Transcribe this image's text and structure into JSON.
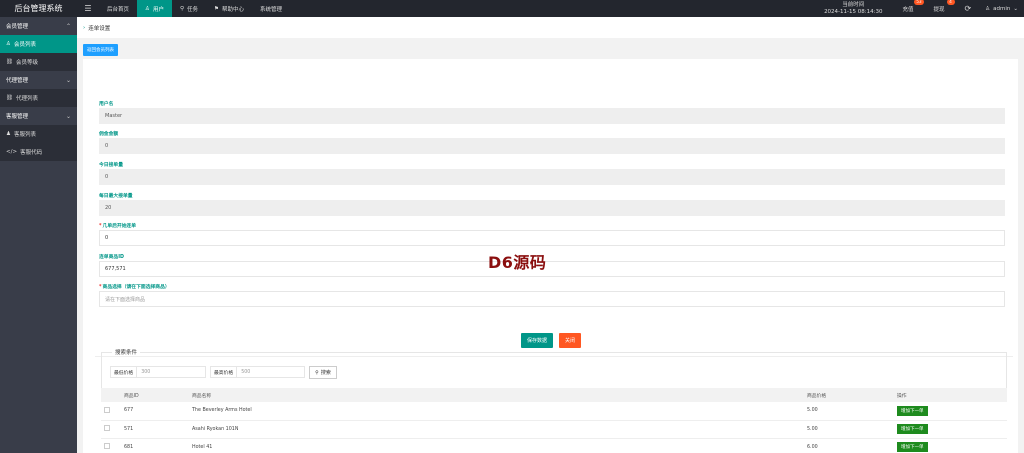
{
  "app": {
    "title": "后台管理系统"
  },
  "topnav": {
    "items": [
      {
        "icon": "menu-icon",
        "label": ""
      },
      {
        "label": "后台首页"
      },
      {
        "label": "用户",
        "active": true
      },
      {
        "label": "任务"
      },
      {
        "label": "帮助中心"
      },
      {
        "label": "系统管理"
      }
    ],
    "clock_label": "当前时间",
    "clock_value": "2024-11-15 08:14:30",
    "recharge_label": "充值",
    "recharge_badge": "53",
    "withdraw_label": "提现",
    "withdraw_badge": "4",
    "user_label": "admin"
  },
  "sidebar": {
    "groups": [
      {
        "label": "会员管理",
        "items": [
          {
            "label": "会员列表",
            "active": true
          },
          {
            "label": "会员等级"
          }
        ]
      },
      {
        "label": "代理管理",
        "items": [
          {
            "label": "代理列表"
          }
        ]
      },
      {
        "label": "客服管理",
        "items": [
          {
            "label": "客服列表"
          },
          {
            "label": "客服代码"
          }
        ]
      }
    ]
  },
  "breadcrumb": {
    "title": "连单设置"
  },
  "back_button": "返回会员列表",
  "form": {
    "username": {
      "label": "用户名",
      "value": "Master"
    },
    "commission": {
      "label": "佣金金额",
      "value": "0"
    },
    "today_orders": {
      "label": "今日接单量",
      "value": "0"
    },
    "daily_max": {
      "label": "每日最大接单量",
      "value": "20"
    },
    "start_after": {
      "label": "几单后开始连单",
      "value": "0"
    },
    "product_ids": {
      "label": "连单商品ID",
      "value": "677,571"
    },
    "select_product": {
      "label": "商品选择（请在下面选择商品）",
      "placeholder": "请在下面选择商品"
    }
  },
  "actions": {
    "save": "保存数据",
    "close": "关闭"
  },
  "watermark": "D6源码",
  "search": {
    "legend": "搜索条件",
    "min_price_label": "最低价格",
    "min_price_placeholder": "300",
    "max_price_label": "最高价格",
    "max_price_placeholder": "500",
    "button": "搜索"
  },
  "table": {
    "headers": [
      "",
      "商品ID",
      "商品名称",
      "商品价格",
      "操作"
    ],
    "rows": [
      {
        "id": "677",
        "name": "The Beverley Arms Hotel",
        "price": "5.00",
        "action": "增加下一单"
      },
      {
        "id": "571",
        "name": "Asahi Ryokan 101N",
        "price": "5.00",
        "action": "增加下一单"
      },
      {
        "id": "681",
        "name": "Hotel 41",
        "price": "6.00",
        "action": "增加下一单"
      }
    ]
  },
  "colors": {
    "accent": "#009688",
    "sidebar": "#393d49",
    "topbar": "#23262e",
    "danger": "#ff5722",
    "primary": "#1e9fff"
  }
}
